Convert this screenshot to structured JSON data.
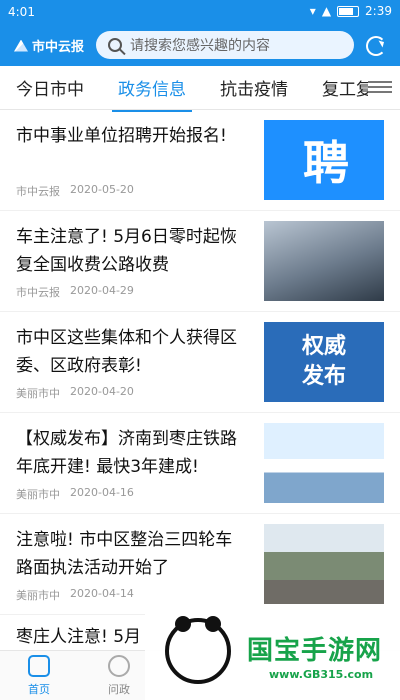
{
  "status": {
    "time": "4:01",
    "clock_right": "2:39"
  },
  "header": {
    "logo_text": "市中云报",
    "search_placeholder": "请搜索您感兴趣的内容"
  },
  "tabs": [
    {
      "label": "今日市中"
    },
    {
      "label": "政务信息"
    },
    {
      "label": "抗击疫情"
    },
    {
      "label": "复工复"
    }
  ],
  "news": [
    {
      "title": "市中事业单位招聘开始报名!",
      "source": "市中云报",
      "date": "2020-05-20",
      "thumb_text": "聘"
    },
    {
      "title": "车主注意了! 5月6日零时起恢复全国收费公路收费",
      "source": "市中云报",
      "date": "2020-04-29",
      "thumb_text": ""
    },
    {
      "title": "市中区这些集体和个人获得区委、区政府表彰!",
      "source": "美丽市中",
      "date": "2020-04-20",
      "thumb_text": "权威\n发布"
    },
    {
      "title": "【权威发布】济南到枣庄铁路年底开建! 最快3年建成!",
      "source": "美丽市中",
      "date": "2020-04-16",
      "thumb_text": ""
    },
    {
      "title": "注意啦! 市中区整治三四轮车路面执法活动开始了",
      "source": "美丽市中",
      "date": "2020-04-14",
      "thumb_text": ""
    }
  ],
  "partial_title": "枣庄人注意! 5月",
  "bottom_nav": [
    {
      "label": "首页"
    },
    {
      "label": "问政"
    }
  ],
  "watermark": {
    "name": "国宝手游网",
    "url": "www.GB315.com"
  },
  "colors": {
    "accent": "#1a8fe8"
  }
}
